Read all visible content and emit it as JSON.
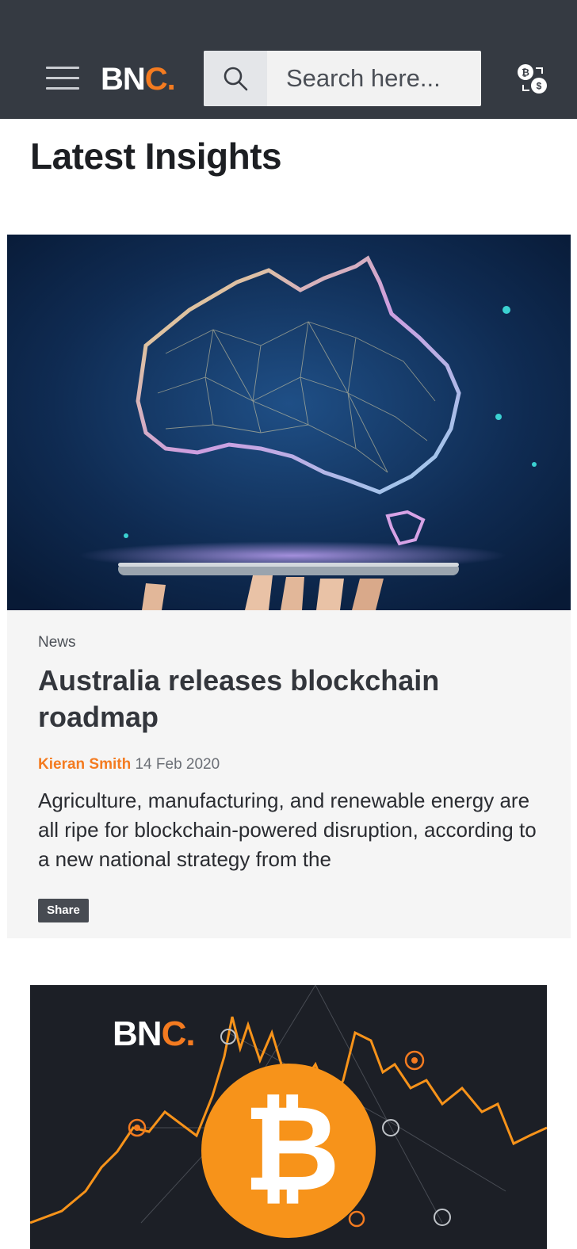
{
  "header": {
    "logo_main": "BN",
    "logo_accent": "C.",
    "search_placeholder": "Search here..."
  },
  "colors": {
    "accent": "#f47b20",
    "topbar": "#353a42"
  },
  "page": {
    "section_title": "Latest Insights"
  },
  "article": {
    "category": "News",
    "headline": "Australia releases blockchain roadmap",
    "author": "Kieran Smith",
    "date": "14 Feb 2020",
    "excerpt": "Agriculture, manufacturing, and renewable energy are all ripe for blockchain-powered disruption, according to a new national strategy from the",
    "share_label": "Share"
  },
  "article2": {
    "logo_main": "BN",
    "logo_accent": "C."
  },
  "icons": [
    "menu-icon",
    "search-icon",
    "currency-converter-icon",
    "bitcoin-icon"
  ]
}
